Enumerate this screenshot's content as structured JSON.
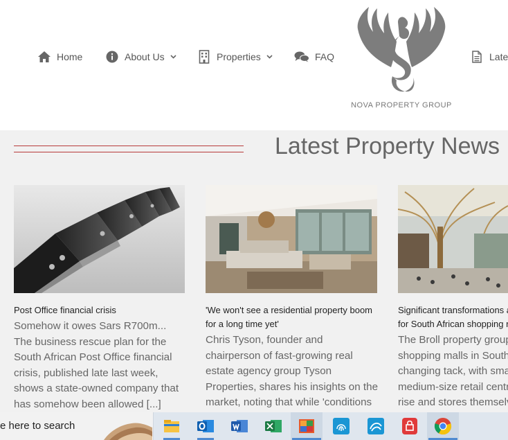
{
  "nav": {
    "items": [
      {
        "label": "Home",
        "icon": "home-icon"
      },
      {
        "label": "About Us",
        "icon": "info-icon",
        "dropdown": true
      },
      {
        "label": "Properties",
        "icon": "building-icon",
        "dropdown": true
      },
      {
        "label": "FAQ",
        "icon": "chat-icon"
      },
      {
        "label": "Lates",
        "icon": "document-icon"
      }
    ],
    "logo_text": "NOVA PROPERTY GROUP"
  },
  "section": {
    "title": "Latest Property News"
  },
  "cards": [
    {
      "title": "Post Office financial crisis",
      "excerpt_lines": [
        "Somehow it owes Sars R700m...",
        "The business rescue plan for the",
        "South African Post Office financial",
        "crisis, published late last week,",
        "shows a state-owned company that",
        "has somehow been allowed [...]"
      ]
    },
    {
      "title_lines": [
        "'We won't see a residential property boom",
        "for a long time yet'"
      ],
      "excerpt_lines": [
        "Chris Tyson, founder and",
        "chairperson of fast-growing real",
        "estate agency group Tyson",
        "Properties, shares his insights on the",
        "market, noting that while 'conditions"
      ]
    },
    {
      "title_lines": [
        "Significant transformations a",
        "for South African shopping r"
      ],
      "excerpt_lines": [
        "The Broll property group",
        "shopping malls in South",
        "changing tack, with sma",
        "medium-size retail centr",
        "rise and stores themselv"
      ]
    }
  ],
  "taskbar": {
    "search_text": "e here to search",
    "apps": [
      "file-explorer-icon",
      "outlook-icon",
      "word-icon",
      "excel-icon",
      "photos-icon",
      "fingerprint-app-icon",
      "wave-app-icon",
      "lock-app-icon",
      "chrome-icon"
    ]
  },
  "colors": {
    "accent_red": "#b73a3a",
    "nav_text": "#555555",
    "title_gray": "#666666"
  }
}
